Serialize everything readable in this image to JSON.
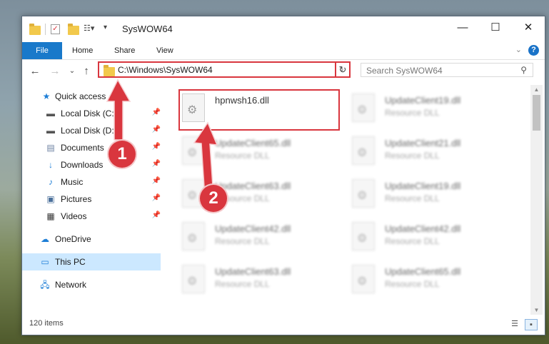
{
  "window": {
    "title": "SysWOW64",
    "minimize": "—",
    "maximize": "☐",
    "close": "✕"
  },
  "ribbon": {
    "file": "File",
    "home": "Home",
    "share": "Share",
    "view": "View",
    "help": "?"
  },
  "nav": {
    "address": "C:\\Windows\\SysWOW64",
    "search_placeholder": "Search SysWOW64"
  },
  "sidebar": {
    "items": [
      {
        "label": "Quick access",
        "icon": "star-icon"
      },
      {
        "label": "Local Disk (C:)",
        "icon": "drive-icon"
      },
      {
        "label": "Local Disk (D:)",
        "icon": "drive-icon"
      },
      {
        "label": "Documents",
        "icon": "documents-icon"
      },
      {
        "label": "Downloads",
        "icon": "download-icon"
      },
      {
        "label": "Music",
        "icon": "music-icon"
      },
      {
        "label": "Pictures",
        "icon": "pictures-icon"
      },
      {
        "label": "Videos",
        "icon": "videos-icon"
      },
      {
        "label": "OneDrive",
        "icon": "cloud-icon"
      },
      {
        "label": "This PC",
        "icon": "computer-icon"
      },
      {
        "label": "Network",
        "icon": "network-icon"
      }
    ]
  },
  "files": [
    {
      "name": "hpnwsh16.dll",
      "type": ""
    },
    {
      "name": "UpdateClient19.dll",
      "type": "Resource DLL"
    },
    {
      "name": "UpdateClient65.dll",
      "type": "Resource DLL"
    },
    {
      "name": "UpdateClient21.dll",
      "type": "Resource DLL"
    },
    {
      "name": "UpdateClient63.dll",
      "type": "Resource DLL"
    },
    {
      "name": "UpdateClient19.dll",
      "type": "Resource DLL"
    },
    {
      "name": "UpdateClient42.dll",
      "type": "Resource DLL"
    },
    {
      "name": "UpdateClient42.dll",
      "type": "Resource DLL"
    },
    {
      "name": "UpdateClient63.dll",
      "type": "Resource DLL"
    },
    {
      "name": "UpdateClient65.dll",
      "type": "Resource DLL"
    }
  ],
  "status": {
    "count": "120 items"
  },
  "annotations": {
    "step1": "1",
    "step2": "2"
  },
  "colors": {
    "accent": "#1979ca",
    "highlight": "#d9363e"
  }
}
